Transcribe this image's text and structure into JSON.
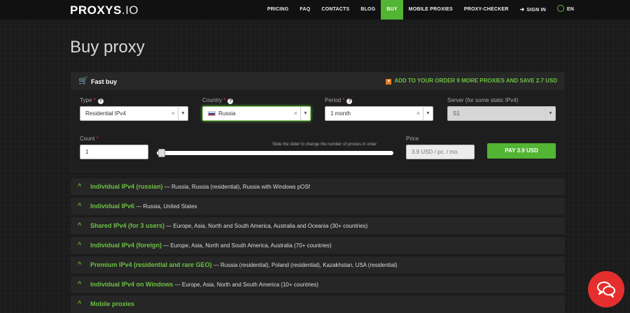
{
  "nav": {
    "logo_main": "PROXYS",
    "logo_tld": ".IO",
    "items": [
      "PRICING",
      "FAQ",
      "CONTACTS",
      "BLOG",
      "BUY",
      "MOBILE PROXIES",
      "PROXY-CHECKER"
    ],
    "active": "BUY",
    "sign_in": "SIGN IN",
    "lang": "EN"
  },
  "page_title": "Buy proxy",
  "fast_buy": {
    "title": "Fast buy",
    "promo": "ADD TO YOUR ORDER 9 MORE PROXIES AND SAVE 2.7 USD",
    "type_label": "Type",
    "type_value": "Residential IPv4",
    "country_label": "Country",
    "country_value": "Russia",
    "period_label": "Period",
    "period_value": "1 month",
    "server_label": "Server (for some static IPv4)",
    "server_value": "S1",
    "count_label": "Count",
    "count_value": "1",
    "slider_hint": "Slide the slider to change the number of proxies in order",
    "price_label": "Price",
    "price_value": "3.9 USD / pc. / mo.",
    "pay_label": "PAY 3.9 USD"
  },
  "accordions": [
    {
      "title": "Individual IPv4 (russian)",
      "desc": " — Russia, Russia (residential), Russia with Windows pOSf"
    },
    {
      "title": "Individual IPv6",
      "desc": " — Russia, United States"
    },
    {
      "title": "Shared IPv4 (for 3 users)",
      "desc": " — Europe, Asia, North and South America, Australia and Oceania (30+ countries)"
    },
    {
      "title": "Individual IPv4 (foreign)",
      "desc": " — Europe, Asia, North and South America, Australia (70+ countries)"
    },
    {
      "title": "Premium IPv4 (residential and rare GEO)",
      "desc": " — Russia (residential), Poland (residential), Kazakhstan, USA (residential)"
    },
    {
      "title": "Individual IPv4 on Windows",
      "desc": " — Europe, Asia, North and South America (10+ countries)"
    },
    {
      "title": "Mobile proxies",
      "desc": ""
    }
  ],
  "icons": {
    "cart": "cart-icon",
    "chat": "chat-icon",
    "globe": "globe-icon",
    "signin": "signin-icon"
  },
  "colors": {
    "accent": "#52b533",
    "danger": "#e53935",
    "chat_bg": "#e52f2f"
  }
}
